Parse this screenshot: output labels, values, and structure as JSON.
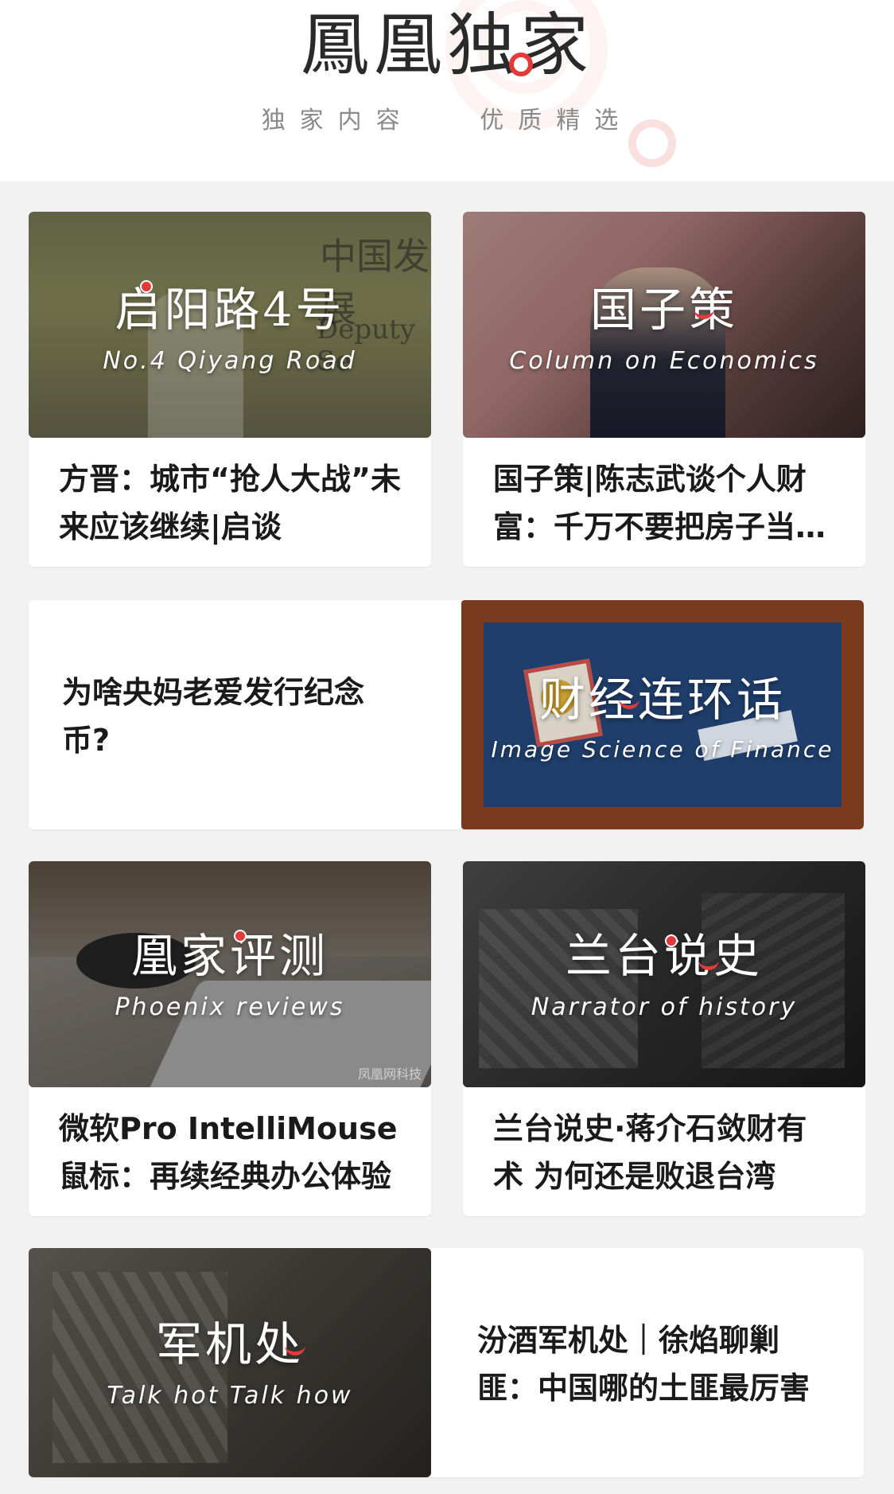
{
  "header": {
    "brand_title": "鳳凰独家",
    "brand_subtitle": "独家内容   优质精选",
    "accent_color": "#e23a3a"
  },
  "cards": [
    {
      "banner_title": "启阳路4号",
      "banner_subtitle": "No.4 Qiyang Road",
      "headline": "方晋：城市“抢人大战”未来应该继续|启谈",
      "banner_bg_text_1": "中国发展",
      "banner_bg_text_2": "Deputy Se"
    },
    {
      "banner_title": "国子策",
      "banner_subtitle": "Column on Economics",
      "headline": "国子策|陈志武谈个人财富：千万不要把房子当作投资"
    },
    {
      "headline": "为啥央妈老爱发行纪念币?",
      "banner_title": "财经连环话",
      "banner_subtitle": "Image Science of Finance"
    },
    {
      "banner_title": "凰家评测",
      "banner_subtitle": "Phoenix reviews",
      "headline": "微软Pro IntelliMouse鼠标：再续经典办公体验",
      "watermark": "凤凰网科技"
    },
    {
      "banner_title": "兰台说史",
      "banner_subtitle": "Narrator of history",
      "headline": "兰台说史·蒋介石敛财有术 为何还是败退台湾"
    },
    {
      "banner_title": "军机处",
      "banner_subtitle": "Talk hot Talk how",
      "headline": "汾酒军机处｜徐焰聊剿匪：中国哪的土匪最厉害"
    }
  ]
}
